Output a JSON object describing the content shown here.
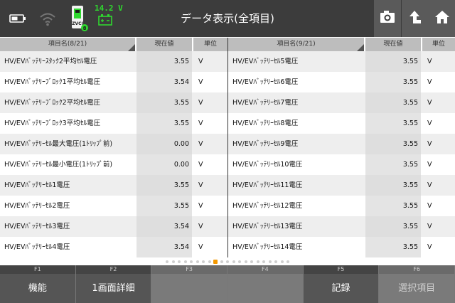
{
  "header": {
    "title": "データ表示(全項目)",
    "voltage": "14.2 V",
    "zvci_label": "ZVCI"
  },
  "left_table": {
    "col_name": "項目名(8/21)",
    "col_value": "現在値",
    "col_unit": "単位",
    "rows": [
      {
        "name": "HV/EVﾊﾞｯﾃﾘｰｽﾀｯｸ2平均ｾﾙ電圧",
        "value": "3.55",
        "unit": "V"
      },
      {
        "name": "HV/EVﾊﾞｯﾃﾘｰﾌﾞﾛｯｸ1平均ｾﾙ電圧",
        "value": "3.54",
        "unit": "V"
      },
      {
        "name": "HV/EVﾊﾞｯﾃﾘｰﾌﾞﾛｯｸ2平均ｾﾙ電圧",
        "value": "3.55",
        "unit": "V"
      },
      {
        "name": "HV/EVﾊﾞｯﾃﾘｰﾌﾞﾛｯｸ3平均ｾﾙ電圧",
        "value": "3.55",
        "unit": "V"
      },
      {
        "name": "HV/EVﾊﾞｯﾃﾘｰｾﾙ最大電圧(1ﾄﾘｯﾌﾟ前)",
        "value": "0.00",
        "unit": "V"
      },
      {
        "name": "HV/EVﾊﾞｯﾃﾘｰｾﾙ最小電圧(1ﾄﾘｯﾌﾟ前)",
        "value": "0.00",
        "unit": "V"
      },
      {
        "name": "HV/EVﾊﾞｯﾃﾘｰｾﾙ1電圧",
        "value": "3.55",
        "unit": "V"
      },
      {
        "name": "HV/EVﾊﾞｯﾃﾘｰｾﾙ2電圧",
        "value": "3.55",
        "unit": "V"
      },
      {
        "name": "HV/EVﾊﾞｯﾃﾘｰｾﾙ3電圧",
        "value": "3.54",
        "unit": "V"
      },
      {
        "name": "HV/EVﾊﾞｯﾃﾘｰｾﾙ4電圧",
        "value": "3.54",
        "unit": "V"
      }
    ]
  },
  "right_table": {
    "col_name": "項目名(9/21)",
    "col_value": "現在値",
    "col_unit": "単位",
    "rows": [
      {
        "name": "HV/EVﾊﾞｯﾃﾘｰｾﾙ5電圧",
        "value": "3.55",
        "unit": "V"
      },
      {
        "name": "HV/EVﾊﾞｯﾃﾘｰｾﾙ6電圧",
        "value": "3.55",
        "unit": "V"
      },
      {
        "name": "HV/EVﾊﾞｯﾃﾘｰｾﾙ7電圧",
        "value": "3.55",
        "unit": "V"
      },
      {
        "name": "HV/EVﾊﾞｯﾃﾘｰｾﾙ8電圧",
        "value": "3.55",
        "unit": "V"
      },
      {
        "name": "HV/EVﾊﾞｯﾃﾘｰｾﾙ9電圧",
        "value": "3.55",
        "unit": "V"
      },
      {
        "name": "HV/EVﾊﾞｯﾃﾘｰｾﾙ10電圧",
        "value": "3.55",
        "unit": "V"
      },
      {
        "name": "HV/EVﾊﾞｯﾃﾘｰｾﾙ11電圧",
        "value": "3.55",
        "unit": "V"
      },
      {
        "name": "HV/EVﾊﾞｯﾃﾘｰｾﾙ12電圧",
        "value": "3.55",
        "unit": "V"
      },
      {
        "name": "HV/EVﾊﾞｯﾃﾘｰｾﾙ13電圧",
        "value": "3.55",
        "unit": "V"
      },
      {
        "name": "HV/EVﾊﾞｯﾃﾘｰｾﾙ14電圧",
        "value": "3.55",
        "unit": "V"
      }
    ]
  },
  "pager": {
    "total_pages": 21,
    "current_page": 9
  },
  "function_keys": [
    {
      "key": "F1",
      "label": "機能",
      "enabled": true
    },
    {
      "key": "F2",
      "label": "1画面詳細",
      "enabled": true
    },
    {
      "key": "F3",
      "label": "",
      "enabled": false
    },
    {
      "key": "F4",
      "label": "",
      "enabled": false
    },
    {
      "key": "F5",
      "label": "記録",
      "enabled": true
    },
    {
      "key": "F6",
      "label": "選択項目",
      "enabled": false
    }
  ],
  "colors": {
    "accent": "#f39800",
    "status_green": "#2fd82f",
    "topbar": "#3c3c3c"
  }
}
